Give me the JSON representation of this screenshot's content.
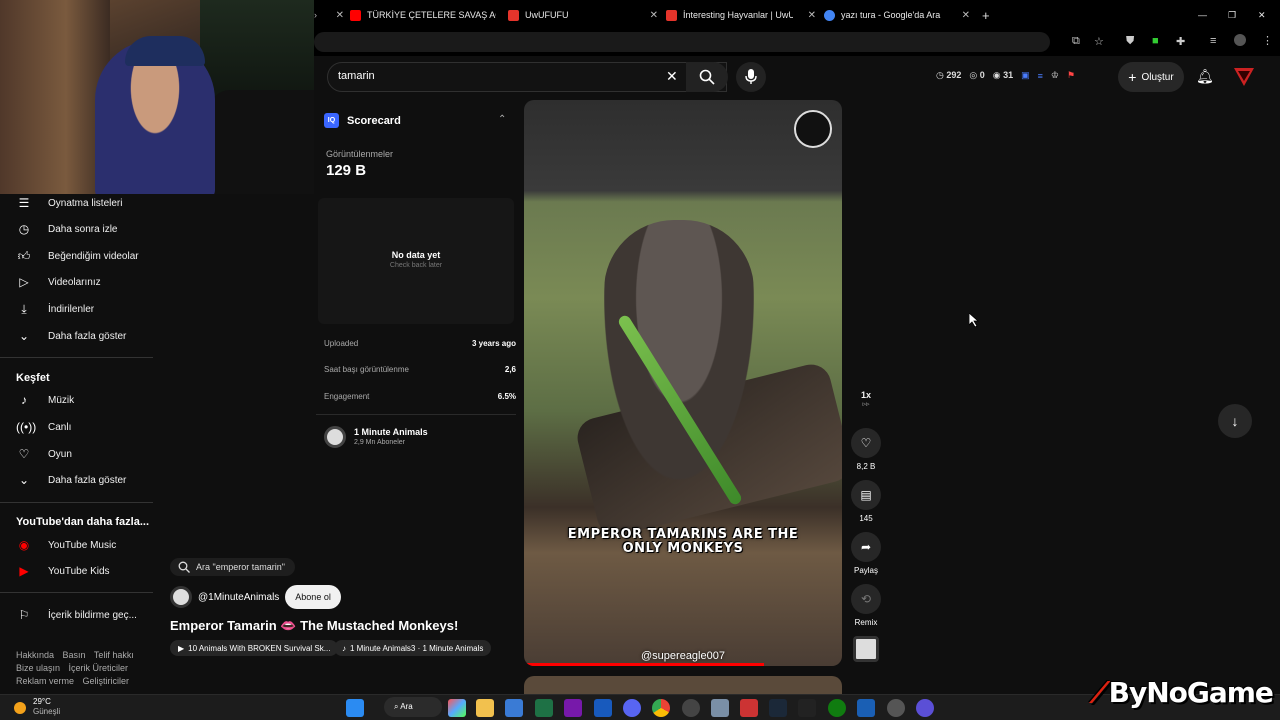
{
  "browser": {
    "tabs": [
      {
        "label": "TÜRKİYE ÇETELERE SAVAŞ AÇTI",
        "color": "#ff0000"
      },
      {
        "label": "UwUFUFU",
        "color": "#e5342b"
      },
      {
        "label": "İnteresting Hayvanlar | UwUFUFU",
        "color": "#e5342b"
      },
      {
        "label": "yazı tura - Google'da Ara",
        "color": "#4285f4"
      }
    ]
  },
  "search": {
    "value": "tamarin"
  },
  "stats": {
    "time": "292",
    "likes": "0",
    "views": "31"
  },
  "header": {
    "create_label": "Oluştur"
  },
  "sidebar": {
    "items": [
      {
        "label": "Oynatma listeleri",
        "icon": "playlist-icon"
      },
      {
        "label": "Daha sonra izle",
        "icon": "clock-icon"
      },
      {
        "label": "Beğendiğim videolar",
        "icon": "thumbs-up-icon"
      },
      {
        "label": "Videolarınız",
        "icon": "play-icon"
      },
      {
        "label": "İndirilenler",
        "icon": "download-icon"
      },
      {
        "label": "Daha fazla göster",
        "icon": "chevron-down-icon"
      }
    ],
    "explore_title": "Keşfet",
    "explore": [
      {
        "label": "Müzik",
        "icon": "music-icon"
      },
      {
        "label": "Canlı",
        "icon": "live-icon"
      },
      {
        "label": "Oyun",
        "icon": "game-icon"
      },
      {
        "label": "Daha fazla göster",
        "icon": "chevron-down-icon"
      }
    ],
    "more_title": "YouTube'dan daha fazla...",
    "more": [
      {
        "label": "YouTube Music",
        "icon": "youtube-music-icon"
      },
      {
        "label": "YouTube Kids",
        "icon": "youtube-kids-icon"
      }
    ],
    "report": "İçerik bildirme geç...",
    "footer": [
      [
        "Hakkında",
        "Basın",
        "Telif hakkı"
      ],
      [
        "Bize ulaşın",
        "İçerik Üreticiler"
      ],
      [
        "Reklam verme",
        "Geliştiriciler"
      ]
    ]
  },
  "scorecard": {
    "title": "Scorecard",
    "views_label": "Görüntülenmeler",
    "views_value": "129 B",
    "no_data": "No data yet",
    "check_back": "Check back later",
    "rows": [
      {
        "label": "Uploaded",
        "value": "3 years ago"
      },
      {
        "label": "Saat başı görüntülenme",
        "value": "2,6"
      },
      {
        "label": "Engagement",
        "value": "6.5%"
      }
    ],
    "channel_name": "1 Minute Animals",
    "channel_subs": "2,9 Mn Aboneler"
  },
  "video": {
    "caption_line1": "EMPEROR TAMARINS ARE THE",
    "caption_line2": "ONLY MONKEYS",
    "watermark": "@supereagle007"
  },
  "actions": {
    "speed": "1x",
    "likes": "8,2 B",
    "comments": "145",
    "share": "Paylaş",
    "remix": "Remix"
  },
  "info": {
    "ask": "Ara \"emperor tamarin\"",
    "channel": "@1MinuteAnimals",
    "subscribe": "Abone ol",
    "title": "Emperor Tamarin 👄 The Mustached Monkeys!",
    "chip1": "10 Animals With BROKEN Survival Sk...",
    "chip2": "1 Minute Animals3 · 1 Minute Animals"
  },
  "taskbar": {
    "weather_temp": "29°C",
    "weather_desc": "Güneşli",
    "search_label": "Ara"
  },
  "overlay": {
    "brand": "ByNoGame"
  }
}
